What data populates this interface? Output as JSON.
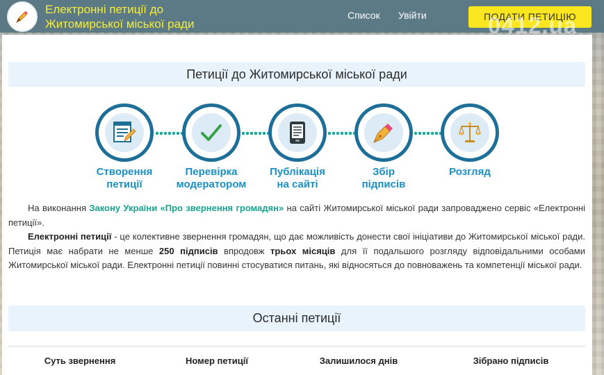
{
  "header": {
    "title_line1": "Електронні петиції до",
    "title_line2": "Житомирської міської ради",
    "nav": [
      "Список",
      "Увійти"
    ],
    "submit_label": "ПОДАТИ ПЕТИЦІЮ",
    "watermark": "0412.ua",
    "bg_color": "#5b7a86",
    "title_color": "#f6ee3a",
    "button_color": "#f9e61f"
  },
  "main": {
    "section_title": "Петиції до Житомирської міської ради",
    "steps": [
      {
        "label_1": "Створення",
        "label_2": "петиції",
        "icon": "form-pencil-icon"
      },
      {
        "label_1": "Перевірка",
        "label_2": "модератором",
        "icon": "checkmark-icon"
      },
      {
        "label_1": "Публікація",
        "label_2": "на сайті",
        "icon": "ereader-icon"
      },
      {
        "label_1": "Збір",
        "label_2": "підписів",
        "icon": "fountain-pen-icon"
      },
      {
        "label_1": "Розгляд",
        "label_2": "",
        "icon": "scales-icon"
      }
    ],
    "para1": {
      "prefix": "На виконання ",
      "link": "Закону України «Про звернення громадян»",
      "suffix": " на сайті Житомирської міської ради запроваджено сервіс «Електронні петиції»."
    },
    "para2": {
      "bold_term": "Електронні петиції",
      "text1": " - це колективне звернення громадян, що дає можливість донести свої ініціативи до Житомирської міської ради. Петиція має набрати не менше ",
      "bold_count": "250 підписів",
      "text2": " впродовж ",
      "bold_period": "трьох місяців",
      "text3": " для її подальшого розгляду відповідальними особами Житомирської міської ради. Електронні петиції повинні стосуватися питань, які відносяться до повноважень та компетенції міської ради."
    },
    "latest_title": "Останні петиції",
    "table_headers": [
      "Суть звернення",
      "Номер петиції",
      "Залишилося днів",
      "Зібрано підписів"
    ]
  }
}
